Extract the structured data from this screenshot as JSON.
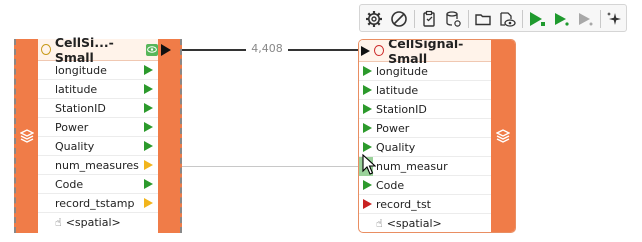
{
  "toolbar": {
    "buttons": [
      {
        "name": "settings-button",
        "icon": "gear-icon"
      },
      {
        "name": "disable-button",
        "icon": "no-entry-icon"
      },
      {
        "name": "cache-button",
        "icon": "clipboard-icon"
      },
      {
        "name": "cache-settings-button",
        "icon": "database-gear-icon"
      },
      {
        "name": "open-cache-button",
        "icon": "folder-icon"
      },
      {
        "name": "inspect-cache-button",
        "icon": "eye-icon"
      },
      {
        "name": "run-to-this-button",
        "icon": "play-green-icon"
      },
      {
        "name": "run-from-this-button",
        "icon": "play-green-small-icon"
      },
      {
        "name": "run-partial-button",
        "icon": "play-gray-icon"
      },
      {
        "name": "auto-layout-button",
        "icon": "sparkle-icon"
      }
    ]
  },
  "connection": {
    "count": "4,408"
  },
  "left_node": {
    "title": "CellSi...-Small",
    "attributes": [
      {
        "label": "longitude",
        "port": "green"
      },
      {
        "label": "latitude",
        "port": "green"
      },
      {
        "label": "StationID",
        "port": "green"
      },
      {
        "label": "Power",
        "port": "green"
      },
      {
        "label": "Quality",
        "port": "green"
      },
      {
        "label": "num_measures",
        "port": "yellow"
      },
      {
        "label": "Code",
        "port": "green"
      },
      {
        "label": "record_tstamp",
        "port": "yellow"
      }
    ],
    "spatial": "<spatial>"
  },
  "right_node": {
    "title": "CellSignal-Small",
    "attributes": [
      {
        "label": "longitude",
        "port": "green"
      },
      {
        "label": "latitude",
        "port": "green"
      },
      {
        "label": "StationID",
        "port": "green"
      },
      {
        "label": "Power",
        "port": "green"
      },
      {
        "label": "Quality",
        "port": "green"
      },
      {
        "label": "num_measur",
        "port": "red"
      },
      {
        "label": "Code",
        "port": "green"
      },
      {
        "label": "record_tst",
        "port": "red"
      }
    ],
    "spatial": "<spatial>"
  },
  "colors": {
    "accent": "#f07c48",
    "port_green": "#2c9a2c",
    "port_yellow": "#f2b51c",
    "port_red": "#c92222"
  }
}
